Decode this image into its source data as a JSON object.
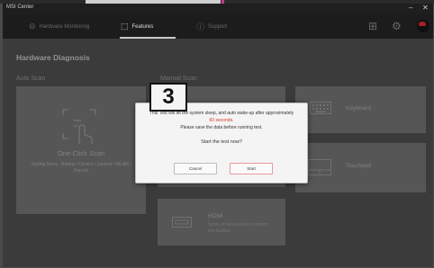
{
  "window": {
    "title": "MSI Center",
    "minimize": "–",
    "close": "✕"
  },
  "nav": {
    "tabs": [
      {
        "label": "Hardware Monitoring",
        "icon": "gauge-icon",
        "glyph": "⊝"
      },
      {
        "label": "Features",
        "icon": "features-icon",
        "glyph": "⬚"
      },
      {
        "label": "Support",
        "icon": "support-icon",
        "glyph": "ⓘ"
      }
    ],
    "active_tab": "Features",
    "grid_icon": "⊞",
    "gear_icon": "⚙"
  },
  "page": {
    "title": "Hardware Diagnosis",
    "auto_scan_label": "Auto Scan",
    "manual_scan_label": "Manual Scan"
  },
  "one_click": {
    "label": "One-Click Scan",
    "testing_items": "Testing Items : Battery / Device / Lanrest / WLAN / Fanout"
  },
  "manual_items": [
    {
      "label": "Keyboard",
      "icon": "keyboard-icon"
    },
    {
      "label": "Touchpad",
      "icon": "touchpad-icon"
    },
    {
      "label": "HDMI",
      "icon": "hdmi-icon",
      "note_line1": "Some of devices don't support",
      "note_line2": "this feature"
    }
  ],
  "dialog": {
    "line1": "This Test will let the system sleep, and auto wake-up after approximately",
    "line2": "60 seconds.",
    "line3": "Please save the data before running test.",
    "question": "Start the test now?",
    "cancel": "Cancel",
    "start": "Start"
  },
  "step_badge": "3",
  "colors": {
    "accent_red": "#d23a2a",
    "dialog_bg": "#f4f4f4",
    "card_bg": "#5b5b5b"
  }
}
